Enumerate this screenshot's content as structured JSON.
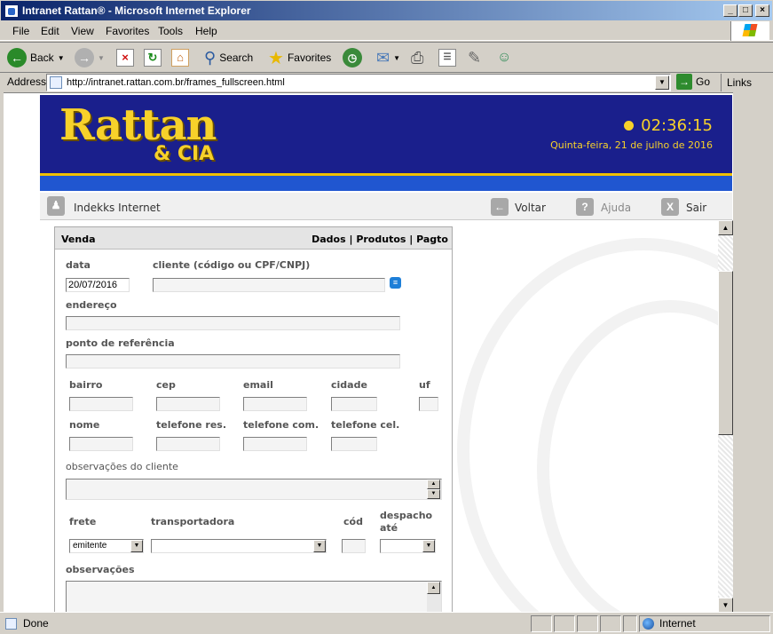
{
  "window": {
    "title": "Intranet Rattan® - Microsoft Internet Explorer",
    "controls": [
      "_",
      "□",
      "×"
    ]
  },
  "menu": [
    "File",
    "Edit",
    "View",
    "Favorites",
    "Tools",
    "Help"
  ],
  "toolbar": {
    "back": "Back",
    "search": "Search",
    "favorites": "Favorites"
  },
  "address": {
    "label": "Address",
    "url": "http://intranet.rattan.com.br/frames_fullscreen.html",
    "go": "Go",
    "links": "Links"
  },
  "header": {
    "logo": "Rattan",
    "logo_sub": "& CIA",
    "time": "02:36:15",
    "date": "Quinta-feira, 21 de julho de 2016",
    "brand_color": "#1a1f8c",
    "accent_color": "#f7d12a"
  },
  "subnav": {
    "user": "Indekks Internet",
    "back": "Voltar",
    "help": "Ajuda",
    "exit": "Sair"
  },
  "form": {
    "panel_title": "Venda",
    "panel_tabs": "Dados | Produtos | Pagto",
    "fields": {
      "data_label": "data",
      "data_value": "20/07/2016",
      "cliente_label": "cliente (código ou CPF/CNPJ)",
      "endereco_label": "endereço",
      "ponto_label": "ponto de referência",
      "bairro_label": "bairro",
      "cep_label": "cep",
      "email_label": "email",
      "cidade_label": "cidade",
      "uf_label": "uf",
      "nome_label": "nome",
      "tel_res_label": "telefone res.",
      "tel_com_label": "telefone com.",
      "tel_cel_label": "telefone cel.",
      "obs_cliente_label": "observações do cliente",
      "frete_label": "frete",
      "frete_value": "emitente",
      "transportadora_label": "transportadora",
      "cod_label": "cód",
      "despacho_label_1": "despacho",
      "despacho_label_2": "até",
      "observacoes_label": "observações"
    }
  },
  "status": {
    "text": "Done",
    "zone": "Internet"
  }
}
